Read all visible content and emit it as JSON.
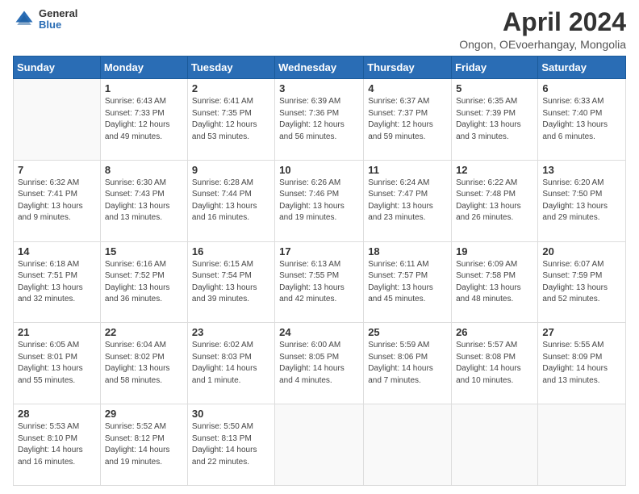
{
  "logo": {
    "general": "General",
    "blue": "Blue"
  },
  "title": "April 2024",
  "subtitle": "Ongon, OEvoerhangay, Mongolia",
  "days_header": [
    "Sunday",
    "Monday",
    "Tuesday",
    "Wednesday",
    "Thursday",
    "Friday",
    "Saturday"
  ],
  "weeks": [
    [
      {
        "day": "",
        "info": ""
      },
      {
        "day": "1",
        "info": "Sunrise: 6:43 AM\nSunset: 7:33 PM\nDaylight: 12 hours\nand 49 minutes."
      },
      {
        "day": "2",
        "info": "Sunrise: 6:41 AM\nSunset: 7:35 PM\nDaylight: 12 hours\nand 53 minutes."
      },
      {
        "day": "3",
        "info": "Sunrise: 6:39 AM\nSunset: 7:36 PM\nDaylight: 12 hours\nand 56 minutes."
      },
      {
        "day": "4",
        "info": "Sunrise: 6:37 AM\nSunset: 7:37 PM\nDaylight: 12 hours\nand 59 minutes."
      },
      {
        "day": "5",
        "info": "Sunrise: 6:35 AM\nSunset: 7:39 PM\nDaylight: 13 hours\nand 3 minutes."
      },
      {
        "day": "6",
        "info": "Sunrise: 6:33 AM\nSunset: 7:40 PM\nDaylight: 13 hours\nand 6 minutes."
      }
    ],
    [
      {
        "day": "7",
        "info": "Sunrise: 6:32 AM\nSunset: 7:41 PM\nDaylight: 13 hours\nand 9 minutes."
      },
      {
        "day": "8",
        "info": "Sunrise: 6:30 AM\nSunset: 7:43 PM\nDaylight: 13 hours\nand 13 minutes."
      },
      {
        "day": "9",
        "info": "Sunrise: 6:28 AM\nSunset: 7:44 PM\nDaylight: 13 hours\nand 16 minutes."
      },
      {
        "day": "10",
        "info": "Sunrise: 6:26 AM\nSunset: 7:46 PM\nDaylight: 13 hours\nand 19 minutes."
      },
      {
        "day": "11",
        "info": "Sunrise: 6:24 AM\nSunset: 7:47 PM\nDaylight: 13 hours\nand 23 minutes."
      },
      {
        "day": "12",
        "info": "Sunrise: 6:22 AM\nSunset: 7:48 PM\nDaylight: 13 hours\nand 26 minutes."
      },
      {
        "day": "13",
        "info": "Sunrise: 6:20 AM\nSunset: 7:50 PM\nDaylight: 13 hours\nand 29 minutes."
      }
    ],
    [
      {
        "day": "14",
        "info": "Sunrise: 6:18 AM\nSunset: 7:51 PM\nDaylight: 13 hours\nand 32 minutes."
      },
      {
        "day": "15",
        "info": "Sunrise: 6:16 AM\nSunset: 7:52 PM\nDaylight: 13 hours\nand 36 minutes."
      },
      {
        "day": "16",
        "info": "Sunrise: 6:15 AM\nSunset: 7:54 PM\nDaylight: 13 hours\nand 39 minutes."
      },
      {
        "day": "17",
        "info": "Sunrise: 6:13 AM\nSunset: 7:55 PM\nDaylight: 13 hours\nand 42 minutes."
      },
      {
        "day": "18",
        "info": "Sunrise: 6:11 AM\nSunset: 7:57 PM\nDaylight: 13 hours\nand 45 minutes."
      },
      {
        "day": "19",
        "info": "Sunrise: 6:09 AM\nSunset: 7:58 PM\nDaylight: 13 hours\nand 48 minutes."
      },
      {
        "day": "20",
        "info": "Sunrise: 6:07 AM\nSunset: 7:59 PM\nDaylight: 13 hours\nand 52 minutes."
      }
    ],
    [
      {
        "day": "21",
        "info": "Sunrise: 6:05 AM\nSunset: 8:01 PM\nDaylight: 13 hours\nand 55 minutes."
      },
      {
        "day": "22",
        "info": "Sunrise: 6:04 AM\nSunset: 8:02 PM\nDaylight: 13 hours\nand 58 minutes."
      },
      {
        "day": "23",
        "info": "Sunrise: 6:02 AM\nSunset: 8:03 PM\nDaylight: 14 hours\nand 1 minute."
      },
      {
        "day": "24",
        "info": "Sunrise: 6:00 AM\nSunset: 8:05 PM\nDaylight: 14 hours\nand 4 minutes."
      },
      {
        "day": "25",
        "info": "Sunrise: 5:59 AM\nSunset: 8:06 PM\nDaylight: 14 hours\nand 7 minutes."
      },
      {
        "day": "26",
        "info": "Sunrise: 5:57 AM\nSunset: 8:08 PM\nDaylight: 14 hours\nand 10 minutes."
      },
      {
        "day": "27",
        "info": "Sunrise: 5:55 AM\nSunset: 8:09 PM\nDaylight: 14 hours\nand 13 minutes."
      }
    ],
    [
      {
        "day": "28",
        "info": "Sunrise: 5:53 AM\nSunset: 8:10 PM\nDaylight: 14 hours\nand 16 minutes."
      },
      {
        "day": "29",
        "info": "Sunrise: 5:52 AM\nSunset: 8:12 PM\nDaylight: 14 hours\nand 19 minutes."
      },
      {
        "day": "30",
        "info": "Sunrise: 5:50 AM\nSunset: 8:13 PM\nDaylight: 14 hours\nand 22 minutes."
      },
      {
        "day": "",
        "info": ""
      },
      {
        "day": "",
        "info": ""
      },
      {
        "day": "",
        "info": ""
      },
      {
        "day": "",
        "info": ""
      }
    ]
  ]
}
